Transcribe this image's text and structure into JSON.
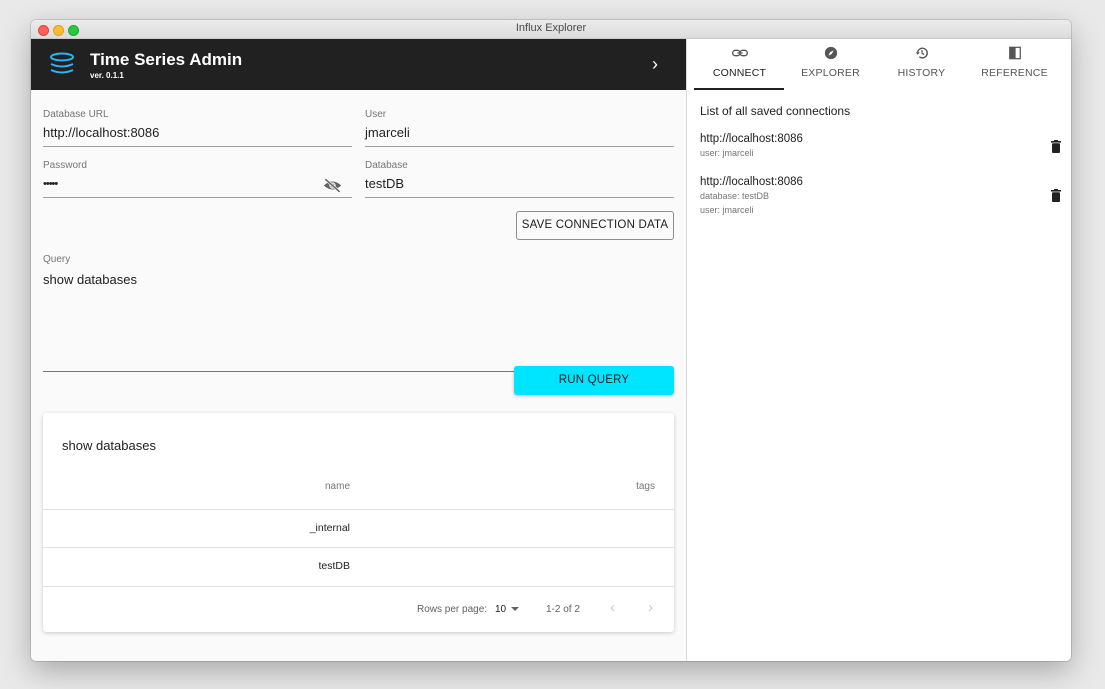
{
  "window": {
    "title": "Influx Explorer"
  },
  "app": {
    "title": "Time Series Admin",
    "version": "ver. 0.1.1"
  },
  "form": {
    "database_url": {
      "label": "Database URL",
      "value": "http://localhost:8086"
    },
    "user": {
      "label": "User",
      "value": "jmarceli"
    },
    "password": {
      "label": "Password",
      "value": "•••••"
    },
    "database": {
      "label": "Database",
      "value": "testDB"
    },
    "save_label": "SAVE CONNECTION DATA",
    "query": {
      "label": "Query",
      "value": "show databases"
    },
    "run_label": "RUN QUERY"
  },
  "results": {
    "title": "show databases",
    "columns": [
      "name",
      "tags"
    ],
    "rows": [
      {
        "name": "_internal",
        "tags": ""
      },
      {
        "name": "testDB",
        "tags": ""
      }
    ],
    "pagination": {
      "rows_per_page_label": "Rows per page:",
      "rows_per_page": "10",
      "range": "1-2 of 2"
    }
  },
  "tabs": [
    {
      "label": "CONNECT",
      "icon": "link-icon",
      "active": true
    },
    {
      "label": "EXPLORER",
      "icon": "compass-icon",
      "active": false
    },
    {
      "label": "HISTORY",
      "icon": "history-icon",
      "active": false
    },
    {
      "label": "REFERENCE",
      "icon": "book-icon",
      "active": false
    }
  ],
  "connections": {
    "header": "List of all saved connections",
    "items": [
      {
        "url": "http://localhost:8086",
        "user": "user: jmarceli"
      },
      {
        "url": "http://localhost:8086",
        "database": "database: testDB",
        "user": "user: jmarceli"
      }
    ]
  },
  "colors": {
    "appbar": "#212121",
    "accent": "#00e5ff",
    "logo": "#29b6f6"
  }
}
